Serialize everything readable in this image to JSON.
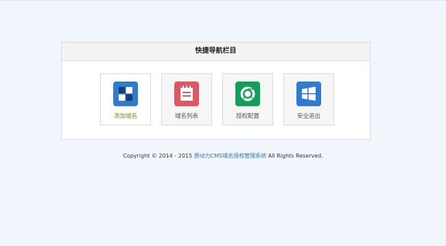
{
  "panel": {
    "title": "快捷导航栏目"
  },
  "tiles": [
    {
      "label": "添加域名",
      "icon": "grid-icon",
      "color": "#2f7bd1"
    },
    {
      "label": "域名列表",
      "icon": "notepad-icon",
      "color": "#e05760"
    },
    {
      "label": "授权配置",
      "icon": "chrome-icon",
      "color": "#11a05b"
    },
    {
      "label": "安全退出",
      "icon": "windows-icon",
      "color": "#2f7bd1"
    }
  ],
  "footer": {
    "prefix": "Copyright © 2014 - 2015 ",
    "link": "原动力CMS域名授权管理系统",
    "suffix": " All Rights Reserved."
  },
  "colors": {
    "page_bg": "#f1f6fd",
    "active_label": "#5e9a1a",
    "link": "#2a76c7"
  }
}
